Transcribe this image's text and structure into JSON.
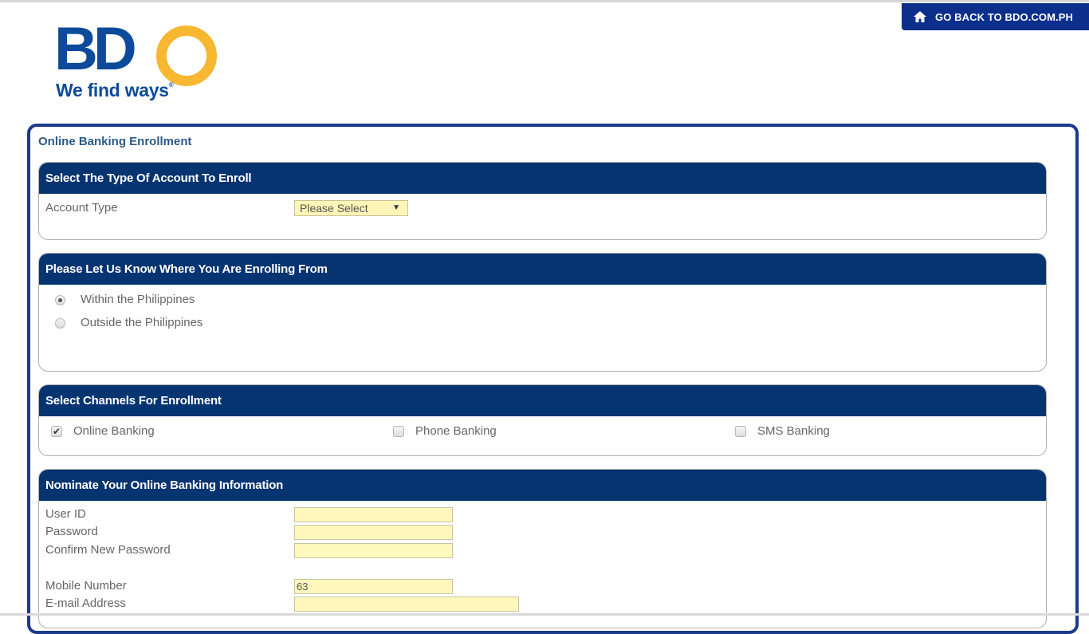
{
  "brand": {
    "name": "BDO",
    "tagline": "We find ways",
    "colors": {
      "primary": "#0d4b9a",
      "accent": "#f7b731",
      "header": "#063470"
    }
  },
  "header": {
    "goback_label": "GO BACK TO BDO.COM.PH",
    "goback_icon": "home-icon"
  },
  "page": {
    "title": "Online Banking Enrollment"
  },
  "sections": {
    "account_type": {
      "heading": "Select The Type Of Account To Enroll",
      "label": "Account Type",
      "selected": "Please Select"
    },
    "location": {
      "heading": "Please Let Us Know Where You Are Enrolling From",
      "options": [
        {
          "label": "Within the Philippines",
          "selected": true
        },
        {
          "label": "Outside the Philippines",
          "selected": false
        }
      ]
    },
    "channels": {
      "heading": "Select Channels For Enrollment",
      "options": [
        {
          "label": "Online Banking",
          "checked": true
        },
        {
          "label": "Phone Banking",
          "checked": false
        },
        {
          "label": "SMS Banking",
          "checked": false
        }
      ]
    },
    "online_info": {
      "heading": "Nominate Your Online Banking Information",
      "fields": [
        {
          "label": "User ID",
          "value": ""
        },
        {
          "label": "Password",
          "value": ""
        },
        {
          "label": "Confirm New Password",
          "value": ""
        },
        {
          "label": "Mobile Number",
          "value": "63"
        },
        {
          "label": "E-mail Address",
          "value": ""
        }
      ]
    }
  }
}
